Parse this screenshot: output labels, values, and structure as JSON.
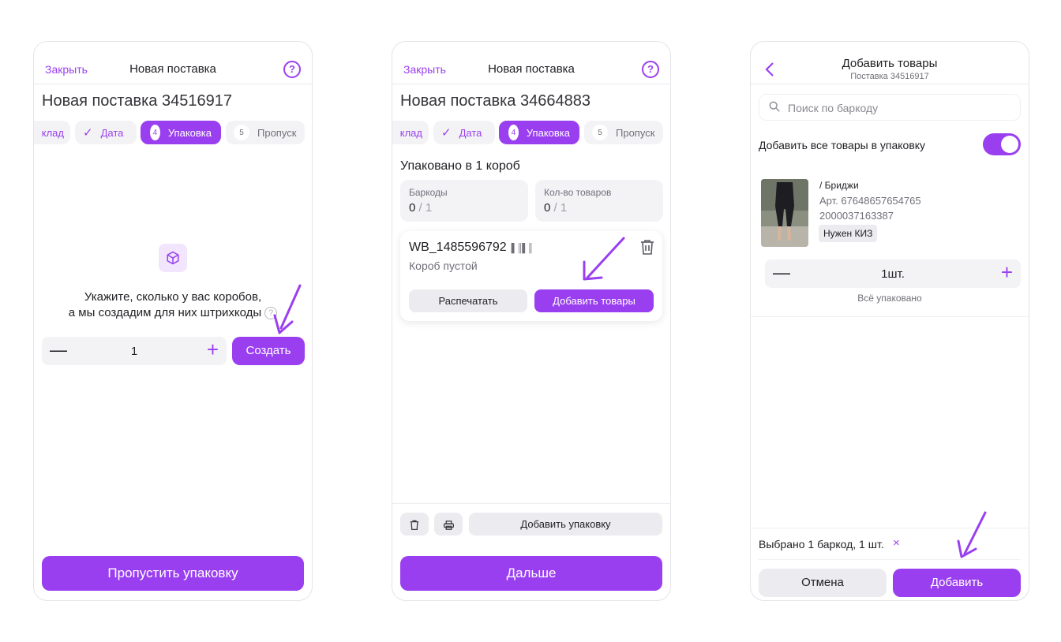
{
  "colors": {
    "accent": "#9a3ff0",
    "muted": "#6f6f78",
    "surface": "#f3f3f6"
  },
  "screen1": {
    "close": "Закрыть",
    "title": "Новая поставка",
    "help": "?",
    "supply": "Новая поставка 34516917",
    "steps": {
      "prev": "клад",
      "date": "Дата",
      "pack_num": "4",
      "pack": "Упаковка",
      "pass_num": "5",
      "pass": "Пропуск"
    },
    "hint_line1": "Укажите, сколько у вас коробов,",
    "hint_line2": "а мы создадим для них штрихкоды",
    "hint_q": "?",
    "quantity": "1",
    "create": "Создать",
    "skip": "Пропустить упаковку",
    "icons": {
      "box": "box-icon",
      "minus": "minus-icon",
      "plus": "plus-icon",
      "arrow": "arrow-annotation"
    }
  },
  "screen2": {
    "close": "Закрыть",
    "title": "Новая поставка",
    "help": "?",
    "supply": "Новая поставка 34664883",
    "steps": {
      "prev": "клад",
      "date": "Дата",
      "pack_num": "4",
      "pack": "Упаковка",
      "pass_num": "5",
      "pass": "Пропуск"
    },
    "packed": "Упаковано в 1 короб",
    "barcodes_label": "Баркоды",
    "barcodes_done": "0",
    "barcodes_total": " / 1",
    "qty_label": "Кол-во товаров",
    "qty_done": "0",
    "qty_total": " / 1",
    "box_code": "WB_1485596792",
    "box_empty": "Короб пустой",
    "print": "Распечатать",
    "add_goods": "Добавить товары",
    "add_pack": "Добавить упаковку",
    "next": "Дальше"
  },
  "screen3": {
    "back": "‹",
    "title": "Добавить товары",
    "subtitle": "Поставка 34516917",
    "search_placeholder": "Поиск по баркоду",
    "toggle_label": "Добавить все товары в упаковку",
    "toggle_on": true,
    "product": {
      "name": "/ Бриджи",
      "art": "Арт. 67648657654765",
      "barcode": "2000037163387",
      "badge": "Нужен КИЗ"
    },
    "quantity": "1шт.",
    "packed_all": "Всё упаковано",
    "selected": "Выбрано 1 баркод, 1 шт.",
    "clear": "×",
    "cancel": "Отмена",
    "add": "Добавить"
  }
}
